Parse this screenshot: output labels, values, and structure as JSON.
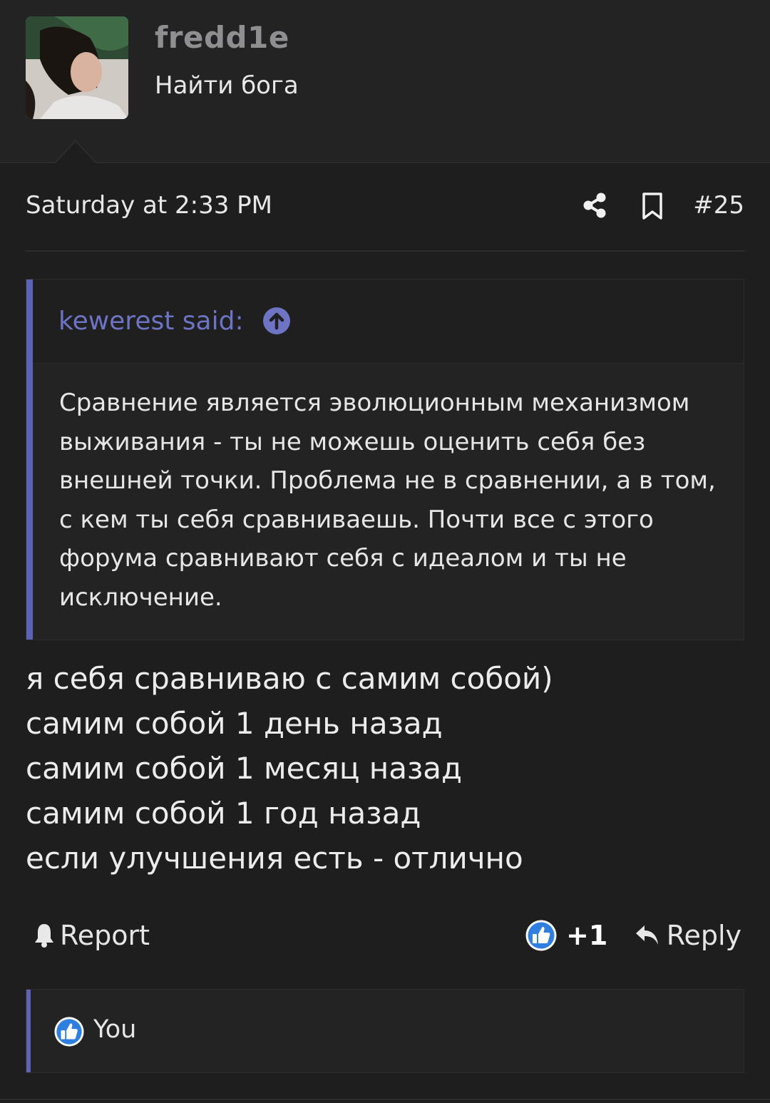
{
  "user": {
    "username": "fredd1e",
    "title": "Найти бога"
  },
  "post": {
    "date": "Saturday at 2:33 PM",
    "number": "#25",
    "icons": [
      "share-icon",
      "bookmark-icon"
    ],
    "quote": {
      "author": "kewerest said:",
      "text": "Сравнение является эволюционным механизмом выживания - ты не можешь оценить себя без внешней точки. Проблема не в сравнении, а в том, с кем ты себя сравниваешь. Почти все с этого форума сравнивают себя с идеалом и ты не исключение."
    },
    "body_lines": [
      "я себя сравниваю с самим собой)",
      "самим собой 1 день назад",
      "самим собой 1 месяц назад",
      "самим собой 1 год назад",
      "если улучшения есть - отлично"
    ]
  },
  "actions": {
    "report_label": "Report",
    "like_count": "+1",
    "reply_label": "Reply"
  },
  "reactions": {
    "user": "You"
  },
  "colors": {
    "background": "#1e1e1f",
    "accent": "#5c63b4",
    "quote_author": "#6d74c4",
    "like_blue": "#2f7fe0"
  }
}
